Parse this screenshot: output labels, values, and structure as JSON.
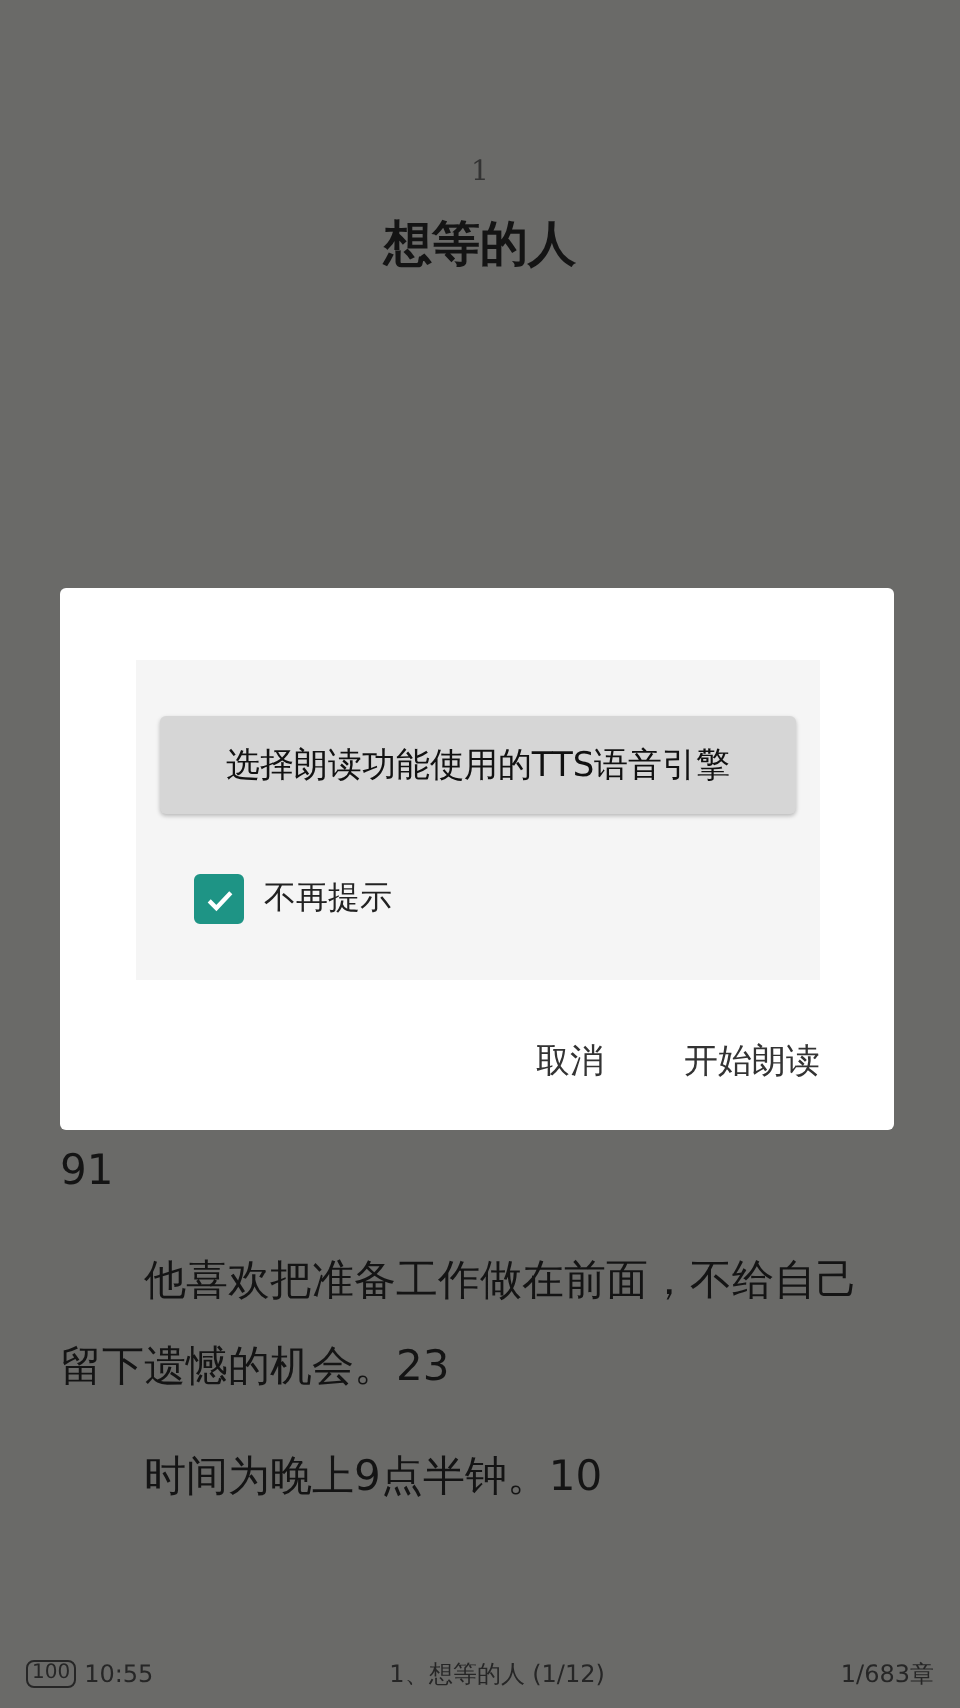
{
  "chapter": {
    "number": "1",
    "title": "想等的人"
  },
  "paragraphs": [
    {
      "text": "91",
      "indent": false
    },
    {
      "text": "他喜欢把准备工作做在前面，不给自己留下遗憾的机会。23",
      "indent": true
    },
    {
      "text": "时间为晚上9点半钟。10",
      "indent": true
    }
  ],
  "dialog": {
    "engine_button": "选择朗读功能使用的TTS语音引擎",
    "checkbox": {
      "label": "不再提示",
      "checked": true
    },
    "buttons": [
      "取消",
      "开始朗读"
    ]
  },
  "status_bar": {
    "battery": "100",
    "time": "10:55",
    "chapter": "1、想等的人 (1/12)",
    "progress": "1/683章"
  }
}
